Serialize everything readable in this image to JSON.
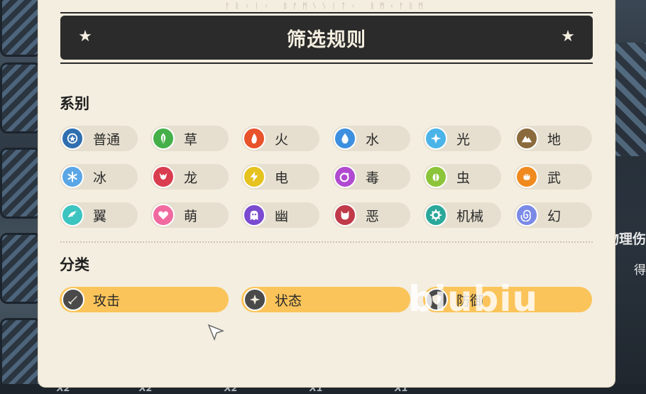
{
  "runes": "ᚨᚱᚲᛁᚲ ᛒᚨᛗᛊᛊᛁᛏᚲ ᚱᛗᚲᚨᚱᛗ",
  "header": {
    "title": "筛选规则"
  },
  "sections": {
    "type": {
      "label": "系别"
    },
    "category": {
      "label": "分类"
    }
  },
  "types": [
    {
      "label": "普通",
      "color": "#2f6fb0",
      "icon": "star-circle-icon"
    },
    {
      "label": "草",
      "color": "#45b04a",
      "icon": "leaf-icon"
    },
    {
      "label": "火",
      "color": "#e8532b",
      "icon": "flame-icon"
    },
    {
      "label": "水",
      "color": "#3d8fe0",
      "icon": "water-drop-icon"
    },
    {
      "label": "光",
      "color": "#4ab4e8",
      "icon": "sparkle-icon"
    },
    {
      "label": "地",
      "color": "#8a6a3c",
      "icon": "mountain-icon"
    },
    {
      "label": "冰",
      "color": "#5aa6e6",
      "icon": "snowflake-icon"
    },
    {
      "label": "龙",
      "color": "#d93d4f",
      "icon": "dragon-icon"
    },
    {
      "label": "电",
      "color": "#e6c21f",
      "icon": "lightning-icon"
    },
    {
      "label": "毒",
      "color": "#b04ad0",
      "icon": "poison-icon"
    },
    {
      "label": "虫",
      "color": "#8cc43a",
      "icon": "bug-icon"
    },
    {
      "label": "武",
      "color": "#f08a1e",
      "icon": "fist-icon"
    },
    {
      "label": "翼",
      "color": "#3cc4c0",
      "icon": "wing-icon"
    },
    {
      "label": "萌",
      "color": "#f06aa0",
      "icon": "heart-icon"
    },
    {
      "label": "幽",
      "color": "#7a4ad0",
      "icon": "ghost-icon"
    },
    {
      "label": "恶",
      "color": "#c03a4a",
      "icon": "demon-icon"
    },
    {
      "label": "机械",
      "color": "#2aa89a",
      "icon": "gear-icon"
    },
    {
      "label": "幻",
      "color": "#7a8ae6",
      "icon": "swirl-icon"
    }
  ],
  "categories": [
    {
      "label": "攻击",
      "icon": "sword-icon"
    },
    {
      "label": "状态",
      "icon": "sparkle-icon"
    },
    {
      "label": "防御",
      "icon": "shield-icon"
    }
  ],
  "background": {
    "right_text_1": "物理伤",
    "right_text_2": "得",
    "bottom_labels": [
      "X2",
      "X2",
      "X2",
      "X1",
      "X1"
    ]
  },
  "watermark": "biubiu",
  "colors": {
    "panel_bg": "#f4eee0",
    "title_bar_bg": "#2b2b2b",
    "chip_bg": "#e6dfcf",
    "category_chip_bg": "#fbc45a"
  }
}
